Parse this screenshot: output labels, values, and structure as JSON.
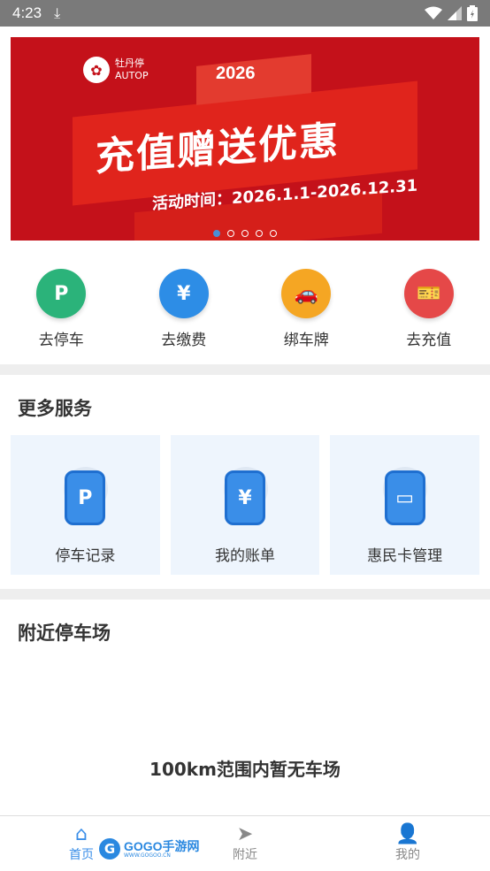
{
  "status": {
    "time": "4:23",
    "download": "⤓"
  },
  "banner": {
    "brand": "牡丹停",
    "brand_en": "AUTOP",
    "year": "2026",
    "title": "充值赠送优惠",
    "date": "活动时间：2026.1.1-2026.12.31",
    "dots": 5,
    "active_dot": 1
  },
  "quick": [
    {
      "label": "去停车",
      "icon": "P",
      "color": "#2bb37a"
    },
    {
      "label": "去缴费",
      "icon": "¥",
      "color": "#2d8de6"
    },
    {
      "label": "绑车牌",
      "icon": "🚗",
      "color": "#f5a623"
    },
    {
      "label": "去充值",
      "icon": "🎫",
      "color": "#e54848"
    }
  ],
  "more_services": {
    "title": "更多服务",
    "items": [
      {
        "label": "停车记录",
        "icon": "P"
      },
      {
        "label": "我的账单",
        "icon": "¥"
      },
      {
        "label": "惠民卡管理",
        "icon": "▭"
      }
    ]
  },
  "nearby": {
    "title": "附近停车场",
    "empty_text": "100km范围内暂无车场"
  },
  "tabs": [
    {
      "label": "首页",
      "icon": "⌂",
      "active": true
    },
    {
      "label": "附近",
      "icon": "➤",
      "active": false
    },
    {
      "label": "我的",
      "icon": "👤",
      "active": false
    }
  ],
  "watermark": {
    "text": "GOGO手游网",
    "sub": "WWW.GOGOO.CN"
  }
}
